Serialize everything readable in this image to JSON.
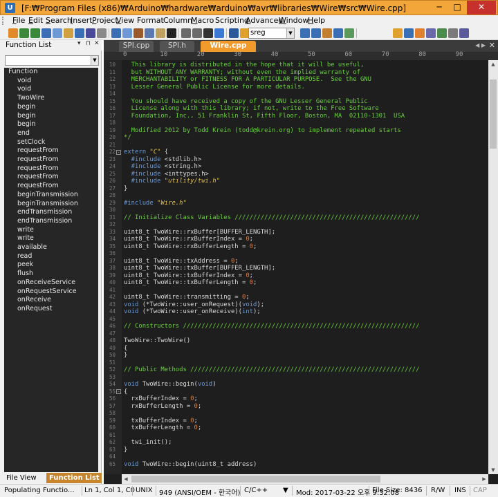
{
  "window": {
    "title": "[F:₩Program Files (x86)₩Arduino₩hardware₩arduino₩avr₩libraries₩Wire₩src₩Wire.cpp] - UltraEdit",
    "minimize": "─",
    "maximize": "□",
    "close": "✕"
  },
  "menu": [
    {
      "underline": "F",
      "rest": "ile"
    },
    {
      "underline": "E",
      "rest": "dit"
    },
    {
      "underline": "S",
      "rest": "earch"
    },
    {
      "underline": "I",
      "rest": "nsert"
    },
    {
      "underline": "P",
      "rest": "roject"
    },
    {
      "underline": "V",
      "rest": "iew"
    },
    {
      "underline": "",
      "rest": "Format"
    },
    {
      "underline": "",
      "rest": "Column"
    },
    {
      "underline": "M",
      "rest": "acro"
    },
    {
      "underline": "",
      "rest": "Scripting"
    },
    {
      "underline": "A",
      "rest": "dvanced"
    },
    {
      "underline": "W",
      "rest": "indow"
    },
    {
      "underline": "H",
      "rest": "elp"
    }
  ],
  "toolbar": {
    "search_value": "sreg",
    "icons": [
      "new-file-icon",
      "open-icon",
      "back-icon",
      "forward-icon",
      "blank-doc-icon",
      "open-folder-icon",
      "save-icon",
      "save-all-icon",
      "close-file-icon",
      "print-icon",
      "print-preview-icon",
      "cut-icon",
      "copy-icon",
      "paste-icon",
      "hex-icon",
      "undo-icon",
      "redo-icon",
      "terminal-icon",
      "word-wrap-icon",
      "browser-icon",
      "find-icon",
      "find-next-icon",
      "find-prev-icon",
      "replace-icon",
      "find-in-files-icon",
      "goto-icon",
      "bookmark-icon",
      "help-icon",
      "tools-icon",
      "compare-icon",
      "ftp-icon",
      "settings-icon",
      "more-icon"
    ]
  },
  "function_list": {
    "title": "Function List",
    "pin": "▾ ⊓ ✕",
    "filter_value": "",
    "root": "Function",
    "items": [
      "void",
      "void",
      "TwoWire",
      "begin",
      "begin",
      "begin",
      "end",
      "setClock",
      "requestFrom",
      "requestFrom",
      "requestFrom",
      "requestFrom",
      "requestFrom",
      "beginTransmission",
      "beginTransmission",
      "endTransmission",
      "endTransmission",
      "write",
      "write",
      "available",
      "read",
      "peek",
      "flush",
      "onReceiveService",
      "onRequestService",
      "onReceive",
      "onRequest"
    ],
    "tabs": {
      "view": "File View",
      "active": "Function List"
    }
  },
  "editor": {
    "tabs": [
      {
        "label": "SPI.cpp",
        "active": false
      },
      {
        "label": "SPI.h",
        "active": false
      },
      {
        "label": "Wire.cpp",
        "active": true
      }
    ],
    "tab_arrows": "◀ ▶",
    "tab_close": "✕",
    "ruler_labels": [
      "0",
      "10",
      "20",
      "30",
      "40",
      "50",
      "60",
      "70",
      "80",
      "90"
    ],
    "lines": [
      {
        "n": "10",
        "spans": [
          {
            "c": "c-com",
            "t": "  This library is distributed in the hope that it will be useful,"
          }
        ]
      },
      {
        "n": "11",
        "spans": [
          {
            "c": "c-com",
            "t": "  but WITHOUT ANY WARRANTY; without even the implied warranty of"
          }
        ]
      },
      {
        "n": "12",
        "spans": [
          {
            "c": "c-com",
            "t": "  MERCHANTABILITY or FITNESS FOR A PARTICULAR PURPOSE.  See the GNU"
          }
        ]
      },
      {
        "n": "13",
        "spans": [
          {
            "c": "c-com",
            "t": "  Lesser General Public License for more details."
          }
        ]
      },
      {
        "n": "14",
        "spans": []
      },
      {
        "n": "15",
        "spans": [
          {
            "c": "c-com",
            "t": "  You should have received a copy of the GNU Lesser General Public"
          }
        ]
      },
      {
        "n": "16",
        "spans": [
          {
            "c": "c-com",
            "t": "  License along with this library; if not, write to the Free Software"
          }
        ]
      },
      {
        "n": "17",
        "spans": [
          {
            "c": "c-com",
            "t": "  Foundation, Inc., 51 Franklin St, Fifth Floor, Boston, MA  02110-1301  USA"
          }
        ]
      },
      {
        "n": "18",
        "spans": []
      },
      {
        "n": "19",
        "spans": [
          {
            "c": "c-com",
            "t": "  Modified 2012 by Todd Krein (todd@krein.org) to implement repeated starts"
          }
        ]
      },
      {
        "n": "20",
        "spans": [
          {
            "c": "c-com",
            "t": "*/"
          }
        ]
      },
      {
        "n": "21",
        "spans": []
      },
      {
        "n": "22",
        "fold": "-",
        "spans": [
          {
            "c": "c-kw",
            "t": "extern "
          },
          {
            "c": "c-str",
            "t": "\"C\""
          },
          {
            "c": "c-def",
            "t": " {"
          }
        ]
      },
      {
        "n": "23",
        "spans": [
          {
            "c": "c-kw",
            "t": "  #include "
          },
          {
            "c": "c-inc",
            "t": "<stdlib.h>"
          }
        ]
      },
      {
        "n": "24",
        "spans": [
          {
            "c": "c-kw",
            "t": "  #include "
          },
          {
            "c": "c-inc",
            "t": "<string.h>"
          }
        ]
      },
      {
        "n": "25",
        "spans": [
          {
            "c": "c-kw",
            "t": "  #include "
          },
          {
            "c": "c-inc",
            "t": "<inttypes.h>"
          }
        ]
      },
      {
        "n": "26",
        "spans": [
          {
            "c": "c-kw",
            "t": "  #include "
          },
          {
            "c": "c-str",
            "t": "\"utility/twi.h\""
          }
        ]
      },
      {
        "n": "27",
        "spans": [
          {
            "c": "c-def",
            "t": "}"
          }
        ]
      },
      {
        "n": "28",
        "spans": []
      },
      {
        "n": "29",
        "spans": [
          {
            "c": "c-kw",
            "t": "#include "
          },
          {
            "c": "c-str",
            "t": "\"Wire.h\""
          }
        ]
      },
      {
        "n": "30",
        "spans": []
      },
      {
        "n": "31",
        "spans": [
          {
            "c": "c-com",
            "t": "// Initialize Class Variables //////////////////////////////////////////////////"
          }
        ]
      },
      {
        "n": "32",
        "spans": []
      },
      {
        "n": "33",
        "spans": [
          {
            "c": "c-def",
            "t": "uint8_t TwoWire::rxBuffer[BUFFER_LENGTH];"
          }
        ]
      },
      {
        "n": "34",
        "spans": [
          {
            "c": "c-def",
            "t": "uint8_t TwoWire::rxBufferIndex = "
          },
          {
            "c": "c-num",
            "t": "0"
          },
          {
            "c": "c-def",
            "t": ";"
          }
        ]
      },
      {
        "n": "35",
        "spans": [
          {
            "c": "c-def",
            "t": "uint8_t TwoWire::rxBufferLength = "
          },
          {
            "c": "c-num",
            "t": "0"
          },
          {
            "c": "c-def",
            "t": ";"
          }
        ]
      },
      {
        "n": "36",
        "spans": []
      },
      {
        "n": "37",
        "spans": [
          {
            "c": "c-def",
            "t": "uint8_t TwoWire::txAddress = "
          },
          {
            "c": "c-num",
            "t": "0"
          },
          {
            "c": "c-def",
            "t": ";"
          }
        ]
      },
      {
        "n": "38",
        "spans": [
          {
            "c": "c-def",
            "t": "uint8_t TwoWire::txBuffer[BUFFER_LENGTH];"
          }
        ]
      },
      {
        "n": "39",
        "spans": [
          {
            "c": "c-def",
            "t": "uint8_t TwoWire::txBufferIndex = "
          },
          {
            "c": "c-num",
            "t": "0"
          },
          {
            "c": "c-def",
            "t": ";"
          }
        ]
      },
      {
        "n": "40",
        "spans": [
          {
            "c": "c-def",
            "t": "uint8_t TwoWire::txBufferLength = "
          },
          {
            "c": "c-num",
            "t": "0"
          },
          {
            "c": "c-def",
            "t": ";"
          }
        ]
      },
      {
        "n": "41",
        "spans": []
      },
      {
        "n": "42",
        "spans": [
          {
            "c": "c-def",
            "t": "uint8_t TwoWire::transmitting = "
          },
          {
            "c": "c-num",
            "t": "0"
          },
          {
            "c": "c-def",
            "t": ";"
          }
        ]
      },
      {
        "n": "43",
        "spans": [
          {
            "c": "c-kw",
            "t": "void"
          },
          {
            "c": "c-def",
            "t": " (*TwoWire::user_onRequest)("
          },
          {
            "c": "c-kw",
            "t": "void"
          },
          {
            "c": "c-def",
            "t": ");"
          }
        ]
      },
      {
        "n": "44",
        "spans": [
          {
            "c": "c-kw",
            "t": "void"
          },
          {
            "c": "c-def",
            "t": " (*TwoWire::user_onReceive)("
          },
          {
            "c": "c-kw",
            "t": "int"
          },
          {
            "c": "c-def",
            "t": ");"
          }
        ]
      },
      {
        "n": "45",
        "spans": []
      },
      {
        "n": "46",
        "spans": [
          {
            "c": "c-com",
            "t": "// Constructors ////////////////////////////////////////////////////////////////"
          }
        ]
      },
      {
        "n": "47",
        "spans": []
      },
      {
        "n": "48",
        "spans": [
          {
            "c": "c-def",
            "t": "TwoWire::TwoWire()"
          }
        ]
      },
      {
        "n": "49",
        "spans": [
          {
            "c": "c-def",
            "t": "{"
          }
        ]
      },
      {
        "n": "50",
        "spans": [
          {
            "c": "c-def",
            "t": "}"
          }
        ]
      },
      {
        "n": "51",
        "spans": []
      },
      {
        "n": "52",
        "spans": [
          {
            "c": "c-com",
            "t": "// Public Methods //////////////////////////////////////////////////////////////"
          }
        ]
      },
      {
        "n": "53",
        "spans": []
      },
      {
        "n": "54",
        "spans": [
          {
            "c": "c-kw",
            "t": "void"
          },
          {
            "c": "c-def",
            "t": " TwoWire::begin("
          },
          {
            "c": "c-kw",
            "t": "void"
          },
          {
            "c": "c-def",
            "t": ")"
          }
        ]
      },
      {
        "n": "55",
        "fold": "-",
        "spans": [
          {
            "c": "c-def",
            "t": "{"
          }
        ]
      },
      {
        "n": "56",
        "spans": [
          {
            "c": "c-def",
            "t": "  rxBufferIndex = "
          },
          {
            "c": "c-num",
            "t": "0"
          },
          {
            "c": "c-def",
            "t": ";"
          }
        ]
      },
      {
        "n": "57",
        "spans": [
          {
            "c": "c-def",
            "t": "  rxBufferLength = "
          },
          {
            "c": "c-num",
            "t": "0"
          },
          {
            "c": "c-def",
            "t": ";"
          }
        ]
      },
      {
        "n": "58",
        "spans": []
      },
      {
        "n": "59",
        "spans": [
          {
            "c": "c-def",
            "t": "  txBufferIndex = "
          },
          {
            "c": "c-num",
            "t": "0"
          },
          {
            "c": "c-def",
            "t": ";"
          }
        ]
      },
      {
        "n": "60",
        "spans": [
          {
            "c": "c-def",
            "t": "  txBufferLength = "
          },
          {
            "c": "c-num",
            "t": "0"
          },
          {
            "c": "c-def",
            "t": ";"
          }
        ]
      },
      {
        "n": "61",
        "spans": []
      },
      {
        "n": "62",
        "spans": [
          {
            "c": "c-def",
            "t": "  twi_init();"
          }
        ]
      },
      {
        "n": "63",
        "spans": [
          {
            "c": "c-def",
            "t": "}"
          }
        ]
      },
      {
        "n": "64",
        "spans": []
      },
      {
        "n": "65",
        "spans": [
          {
            "c": "c-kw",
            "t": "void"
          },
          {
            "c": "c-def",
            "t": " TwoWire::begin(uint8_t address)"
          }
        ]
      }
    ]
  },
  "status": {
    "message": "Populating Functio...",
    "position": "Ln 1, Col 1, C0",
    "line_ending": "UNIX",
    "encoding": "949  (ANSI/OEM - 한국어)",
    "language": "C/C++",
    "modified": "Mod: 2017-03-22 오후 9:32:08",
    "file_size": "File Size: 8436",
    "rw": "R/W",
    "ins": "INS",
    "caps": "CAP"
  },
  "colors": {
    "title_bar": "#f3a73a",
    "active_tab": "#f09b2c",
    "editor_bg": "#1e1e1e",
    "comment": "#6bd13d",
    "keyword": "#6a9bd8",
    "string": "#e0c050",
    "number": "#e07a3b"
  }
}
